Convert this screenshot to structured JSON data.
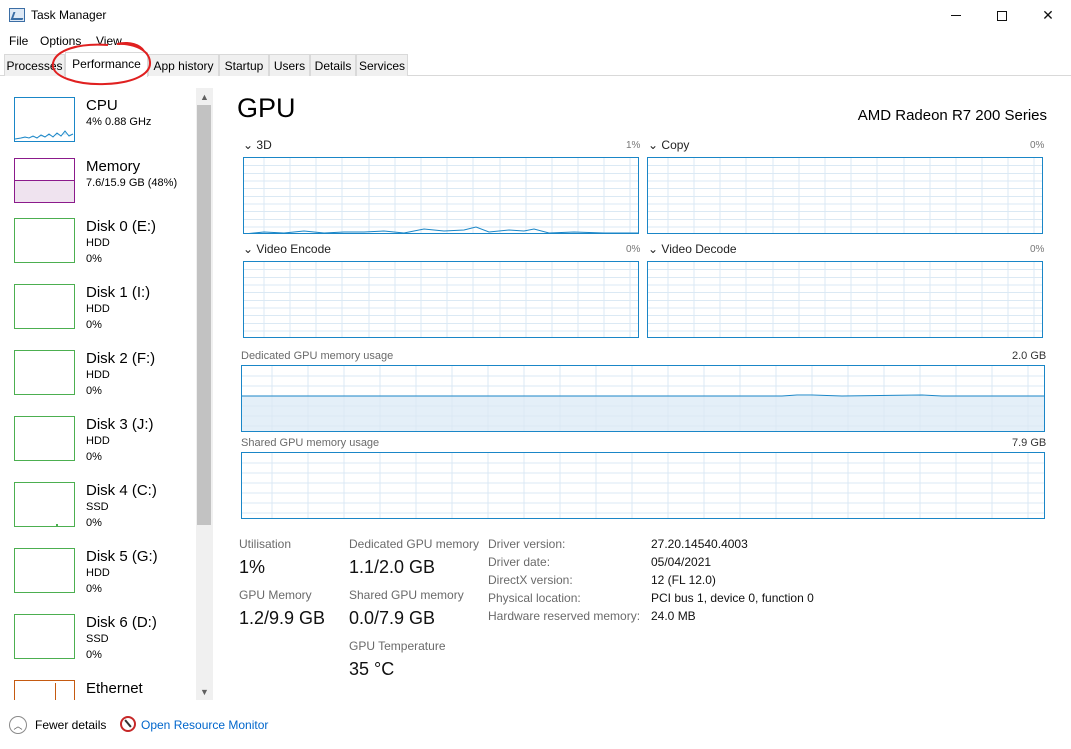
{
  "window": {
    "title": "Task Manager",
    "minimize_icon": "minimize-icon",
    "maximize_icon": "maximize-icon",
    "close_glyph": "✕"
  },
  "menu": [
    "File",
    "Options",
    "View"
  ],
  "tabs": [
    {
      "label": "Processes",
      "active": false
    },
    {
      "label": "Performance",
      "active": true
    },
    {
      "label": "App history",
      "active": false
    },
    {
      "label": "Startup",
      "active": false
    },
    {
      "label": "Users",
      "active": false
    },
    {
      "label": "Details",
      "active": false
    },
    {
      "label": "Services",
      "active": false
    }
  ],
  "annotation": {
    "color": "#e02020",
    "target": "Performance tab"
  },
  "resources": [
    {
      "name": "CPU",
      "sub1": "4%  0.88 GHz",
      "sub2": "",
      "color": "#1a86c7"
    },
    {
      "name": "Memory",
      "sub1": "7.6/15.9 GB (48%)",
      "sub2": "",
      "color": "#8b1a8b"
    },
    {
      "name": "Disk 0 (E:)",
      "sub1": "HDD",
      "sub2": "0%",
      "color": "#4caf50"
    },
    {
      "name": "Disk 1 (I:)",
      "sub1": "HDD",
      "sub2": "0%",
      "color": "#4caf50"
    },
    {
      "name": "Disk 2 (F:)",
      "sub1": "HDD",
      "sub2": "0%",
      "color": "#4caf50"
    },
    {
      "name": "Disk 3 (J:)",
      "sub1": "HDD",
      "sub2": "0%",
      "color": "#4caf50"
    },
    {
      "name": "Disk 4 (C:)",
      "sub1": "SSD",
      "sub2": "0%",
      "color": "#4caf50"
    },
    {
      "name": "Disk 5 (G:)",
      "sub1": "HDD",
      "sub2": "0%",
      "color": "#4caf50"
    },
    {
      "name": "Disk 6 (D:)",
      "sub1": "SSD",
      "sub2": "0%",
      "color": "#4caf50"
    },
    {
      "name": "Ethernet",
      "sub1": "",
      "sub2": "",
      "color": "#c55a11"
    }
  ],
  "main": {
    "title": "GPU",
    "gpu_name": "AMD Radeon R7 200 Series",
    "engines": [
      {
        "label": "3D",
        "pct": "1%"
      },
      {
        "label": "Copy",
        "pct": "0%"
      },
      {
        "label": "Video Encode",
        "pct": "0%"
      },
      {
        "label": "Video Decode",
        "pct": "0%"
      }
    ],
    "dedicated_mem": {
      "label": "Dedicated GPU memory usage",
      "max": "2.0 GB"
    },
    "shared_mem": {
      "label": "Shared GPU memory usage",
      "max": "7.9 GB"
    },
    "stats": {
      "utilisation_label": "Utilisation",
      "utilisation": "1%",
      "dedicated_label": "Dedicated GPU memory",
      "dedicated": "1.1/2.0 GB",
      "gpu_memory_label": "GPU Memory",
      "gpu_memory": "1.2/9.9 GB",
      "shared_label": "Shared GPU memory",
      "shared": "0.0/7.9 GB",
      "temp_label": "GPU Temperature",
      "temp": "35 °C"
    },
    "info": [
      {
        "key": "Driver version:",
        "value": "27.20.14540.4003"
      },
      {
        "key": "Driver date:",
        "value": "05/04/2021"
      },
      {
        "key": "DirectX version:",
        "value": "12 (FL 12.0)"
      },
      {
        "key": "Physical location:",
        "value": "PCI bus 1, device 0, function 0"
      },
      {
        "key": "Hardware reserved memory:",
        "value": "24.0 MB"
      }
    ]
  },
  "footer": {
    "fewer_details": "Fewer details",
    "open_resource_monitor": "Open Resource Monitor"
  },
  "colors": {
    "gpu_line": "#1a86c7",
    "grid": "#dbe9f4",
    "accent_link": "#0066cc"
  }
}
